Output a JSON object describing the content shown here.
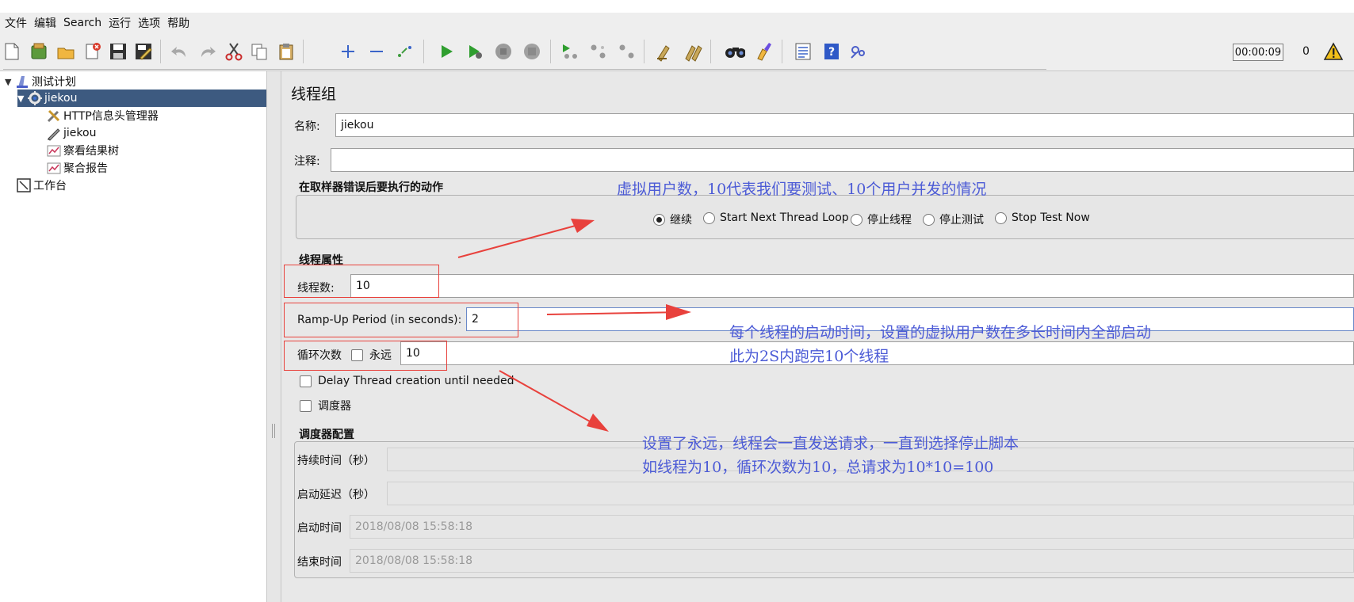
{
  "titlebar": {
    "text": ""
  },
  "menu": [
    {
      "label": "文件"
    },
    {
      "label": "编辑"
    },
    {
      "label": "Search"
    },
    {
      "label": "运行"
    },
    {
      "label": "选项"
    },
    {
      "label": "帮助"
    }
  ],
  "toolbar": {
    "icons": [
      "new-file-icon",
      "templates-icon",
      "open-icon",
      "close-icon",
      "save-icon",
      "save-as-icon",
      "undo-icon",
      "redo-icon",
      "cut-icon",
      "copy-icon",
      "paste-icon",
      "expand-icon",
      "collapse-icon",
      "toggle-icon",
      "start-icon",
      "start-no-pause-icon",
      "stop-icon",
      "shutdown-icon",
      "remote-start-icon",
      "remote-stop-icon",
      "remote-shutdown-icon",
      "clear-icon",
      "clear-all-icon",
      "search-icon",
      "reset-search-icon",
      "function-helper-icon",
      "help-icon",
      "log-viewer-icon"
    ],
    "timer": "00:00:09",
    "active_threads": "0",
    "warning_icon": "warning-icon"
  },
  "tree": {
    "nodes": [
      {
        "label": "测试计划",
        "icon": "test-plan-icon"
      },
      {
        "label": "jiekou",
        "icon": "thread-group-gear-icon"
      },
      {
        "label": "HTTP信息头管理器",
        "icon": "header-manager-tools-icon"
      },
      {
        "label": "jiekou",
        "icon": "sampler-pen-icon"
      },
      {
        "label": "察看结果树",
        "icon": "listener-chart-icon"
      },
      {
        "label": "聚合报告",
        "icon": "listener-chart-icon"
      },
      {
        "label": "工作台",
        "icon": "workbench-icon"
      }
    ]
  },
  "panel": {
    "title": "线程组",
    "name_label": "名称:",
    "name_value": "jiekou",
    "comment_label": "注释:",
    "comment_value": "",
    "error_section": "在取样器错误后要执行的动作",
    "error_actions": [
      {
        "label": "继续",
        "selected": true
      },
      {
        "label": "Start Next Thread Loop",
        "selected": false
      },
      {
        "label": "停止线程",
        "selected": false
      },
      {
        "label": "停止测试",
        "selected": false
      },
      {
        "label": "Stop Test Now",
        "selected": false
      }
    ],
    "thread_section": "线程属性",
    "threads_label": "线程数:",
    "threads_value": "10",
    "rampup_label": "Ramp-Up Period (in seconds):",
    "rampup_value": "2",
    "loop_label": "循环次数",
    "forever_label": "永远",
    "loop_value": "10",
    "delay_label": "Delay Thread creation until needed",
    "scheduler_label": "调度器",
    "scheduler_section": "调度器配置",
    "duration_label": "持续时间（秒）",
    "startup_delay_label": "启动延迟（秒）",
    "start_time_label": "启动时间",
    "start_time_value": "2018/08/08 15:58:18",
    "end_time_label": "结束时间",
    "end_time_value": "2018/08/08 15:58:18"
  },
  "annotations": {
    "note_users": "虚拟用户数，10代表我们要测试、10个用户并发的情况",
    "note_rampup_1": "每个线程的启动时间，设置的虚拟用户数在多长时间内全部启动",
    "note_rampup_2": "此为2S内跑完10个线程",
    "note_loop_1": "设置了永远，线程会一直发送请求，一直到选择停止脚本",
    "note_loop_2": "如线程为10，循环次数为10，总请求为10*10=100",
    "annotation_color": "#4c5bd6",
    "highlight_color": "#e8413c"
  }
}
